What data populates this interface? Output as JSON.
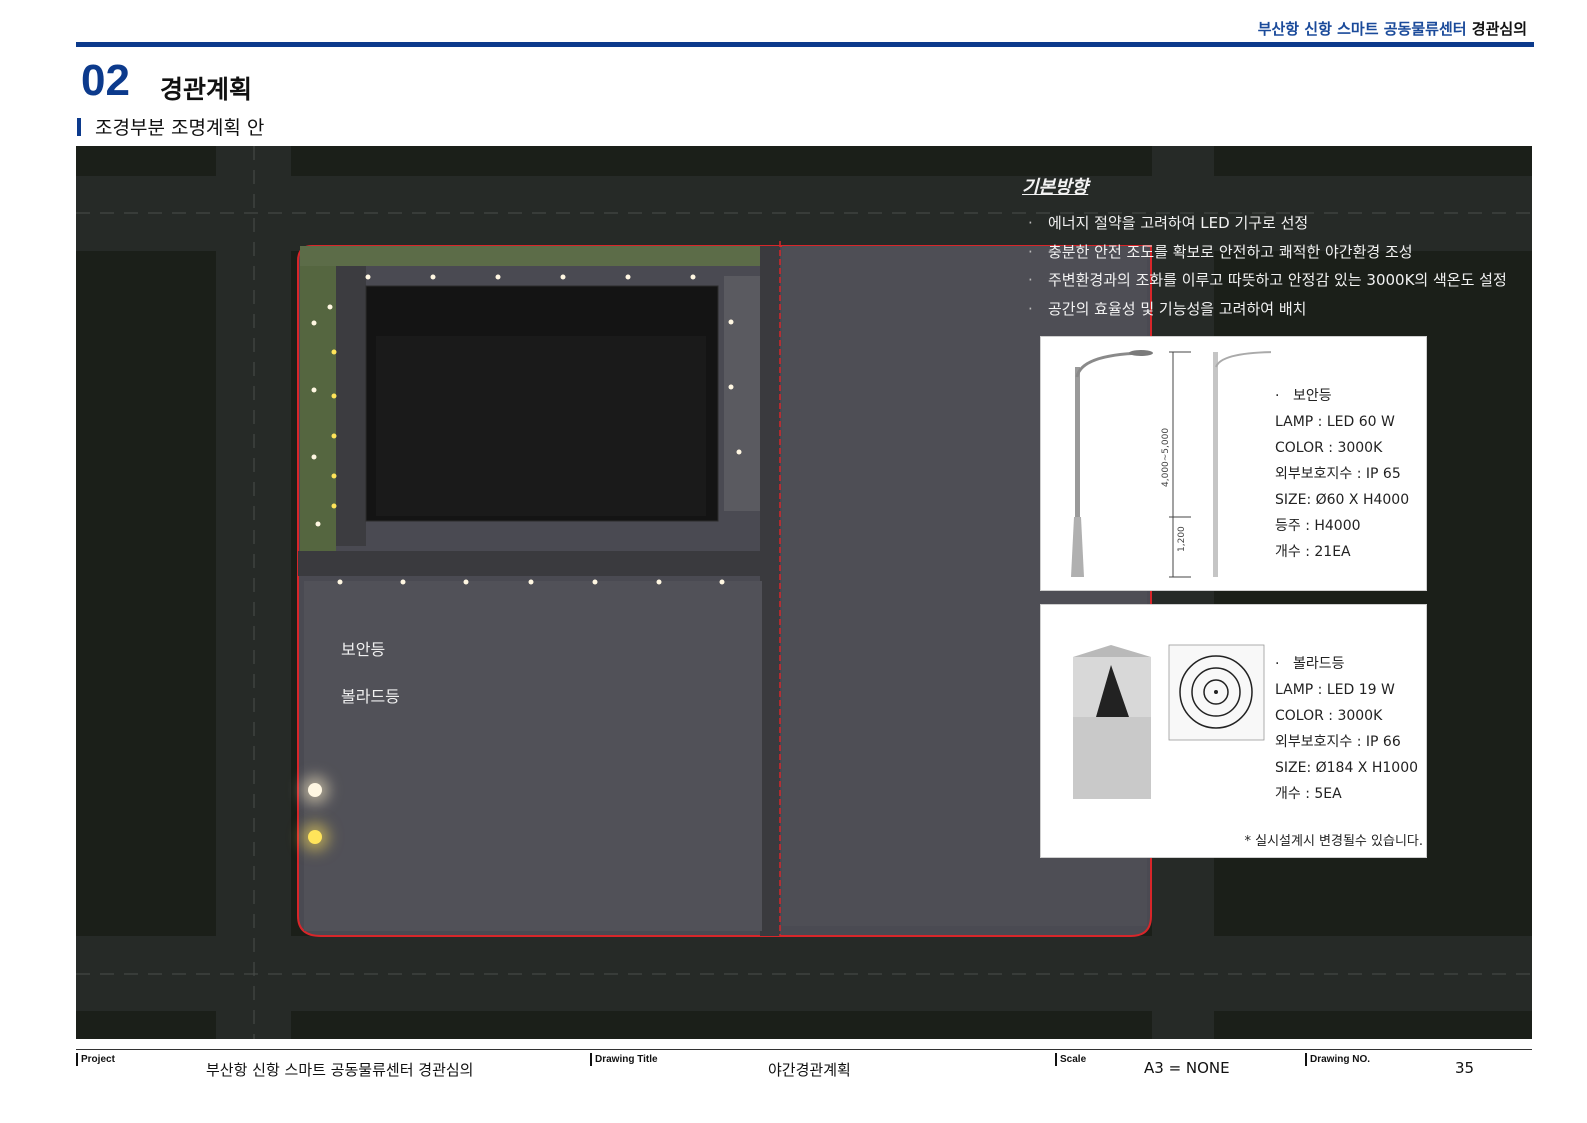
{
  "header": {
    "project_title_blue": "부산항 신항 스마트 공동물류센터",
    "project_title_black": "경관심의"
  },
  "section": {
    "number": "02",
    "title": "경관계획",
    "subtitle": "조경부분 조명계획 안"
  },
  "legend": [
    {
      "label": "보안등",
      "color": "#fff7e2"
    },
    {
      "label": "볼라드등",
      "color": "#ffe45a"
    }
  ],
  "basic_direction": {
    "title": "기본방향",
    "items": [
      "에너지 절약을 고려하여 LED 기구로 선정",
      "충분한 안전 조도를 확보로 안전하고 쾌적한 야간환경 조성",
      "주변환경과의 조화를 이루고 따뜻하고 안정감 있는 3000K의 색온도 설정",
      "공간의 효율성 및 기능성을 고려하여 배치"
    ]
  },
  "security_light": {
    "name": "보안등",
    "lamp": "LAMP : LED 60 W",
    "color": "COLOR : 3000K",
    "ip": "외부보호지수 : IP 65",
    "size": "SIZE: Ø60 X H4000",
    "pole": "등주 : H4000",
    "count": "개수 : 21EA",
    "dim_height": "4,000~5,000",
    "dim_base": "1,200"
  },
  "bollard_light": {
    "name": "볼라드등",
    "lamp": "LAMP : LED 19 W",
    "color": "COLOR : 3000K",
    "ip": "외부보호지수 : IP 66",
    "size": "SIZE: Ø184 X H1000",
    "count": "개수 : 5EA",
    "note": "* 실시설계시 변경될수 있습니다."
  },
  "footer": {
    "project_label": "Project",
    "project_value": "부산항 신항 스마트 공동물류센터 경관심의",
    "drawing_title_label": "Drawing Title",
    "drawing_title_value": "야간경관계획",
    "scale_label": "Scale",
    "scale_value": "A3 = NONE",
    "drawing_no_label": "Drawing NO.",
    "drawing_no_value": "35"
  },
  "colors": {
    "accent_blue": "#0c3a8c",
    "site_boundary": "#d8262a",
    "night_background": "#1b1f19"
  }
}
